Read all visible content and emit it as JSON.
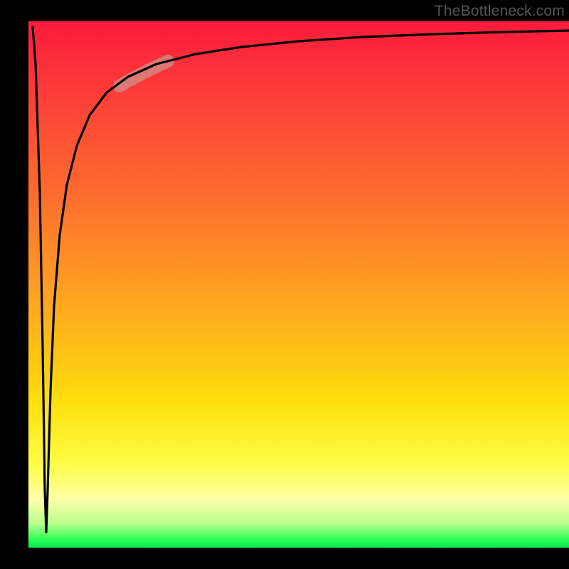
{
  "watermark": {
    "text": "TheBottleneck.com"
  },
  "colors": {
    "frame": "#000000",
    "curve": "#000000",
    "highlight": "#d08f8a",
    "gradient_stops": [
      "#fb1a3a",
      "#fd6a2f",
      "#fede0b",
      "#fffd45",
      "#b6ff8a",
      "#00e84a"
    ]
  },
  "chart_data": {
    "type": "line",
    "title": "",
    "xlabel": "",
    "ylabel": "",
    "xlim": [
      0,
      100
    ],
    "ylim": [
      0,
      100
    ],
    "grid": false,
    "legend": "none",
    "background": "vertical-gradient red→green",
    "series": [
      {
        "name": "bottleneck-curve",
        "description": "Sharp dip to ~0 near x≈3 then logarithmic rise toward ~98",
        "x": [
          0,
          1.5,
          2.5,
          3.0,
          3.5,
          4.5,
          6,
          8,
          11,
          15,
          20,
          27,
          36,
          48,
          62,
          80,
          100
        ],
        "values": [
          98.8,
          80,
          40,
          3,
          40,
          60,
          72,
          79,
          84,
          87.7,
          90.3,
          92.5,
          94.3,
          95.6,
          96.6,
          97.4,
          98.0
        ]
      }
    ],
    "annotations": [
      {
        "name": "highlight-segment",
        "type": "line-segment-overlay",
        "x_range": [
          17,
          26
        ],
        "color": "#d08f8a",
        "thickness_px": 18
      }
    ]
  }
}
